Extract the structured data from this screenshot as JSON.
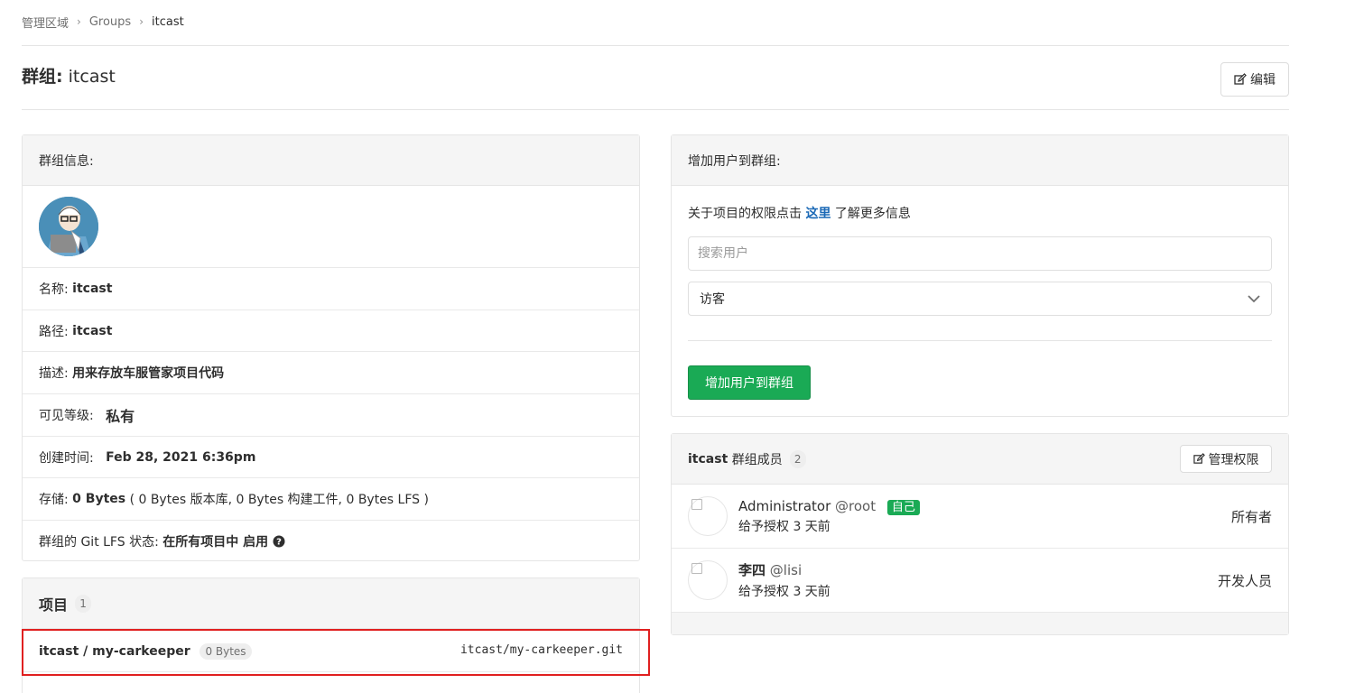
{
  "breadcrumb": {
    "items": [
      "管理区域",
      "Groups",
      "itcast"
    ]
  },
  "header": {
    "title_prefix": "群组:",
    "title_name": "itcast",
    "edit_label": "编辑"
  },
  "group_info": {
    "heading": "群组信息:",
    "name_label": "名称:",
    "name_value": "itcast",
    "path_label": "路径:",
    "path_value": "itcast",
    "desc_label": "描述:",
    "desc_value": "用来存放车服管家项目代码",
    "visibility_label": "可见等级:",
    "visibility_value": "私有",
    "created_label": "创建时间:",
    "created_value": "Feb 28, 2021 6:36pm",
    "storage_label": "存储:",
    "storage_value": "0 Bytes",
    "storage_detail": "( 0 Bytes 版本库, 0 Bytes 构建工件, 0 Bytes LFS )",
    "lfs_label": "群组的 Git LFS 状态:",
    "lfs_value": "在所有项目中 启用"
  },
  "projects": {
    "heading": "项目",
    "count": "1",
    "items": [
      {
        "name": "itcast / my-carkeeper",
        "size": "0 Bytes",
        "git_path": "itcast/my-carkeeper.git"
      }
    ]
  },
  "add_user": {
    "heading": "增加用户到群组:",
    "perm_text_before": "关于项目的权限点击",
    "perm_link": "这里",
    "perm_text_after": "了解更多信息",
    "search_placeholder": "搜索用户",
    "role_selected": "访客",
    "submit_label": "增加用户到群组"
  },
  "members": {
    "group_name": "itcast",
    "heading_suffix": "群组成员",
    "count": "2",
    "manage_label": "管理权限",
    "items": [
      {
        "name": "Administrator",
        "username": "@root",
        "badge": "自己",
        "granted": "给予授权 3 天前",
        "role": "所有者"
      },
      {
        "name": "李四",
        "username": "@lisi",
        "badge": "",
        "granted": "给予授权 3 天前",
        "role": "开发人员"
      }
    ]
  },
  "colors": {
    "accent_green": "#1aaa55",
    "link_blue": "#1b69b6",
    "highlight_red": "#e02020"
  }
}
